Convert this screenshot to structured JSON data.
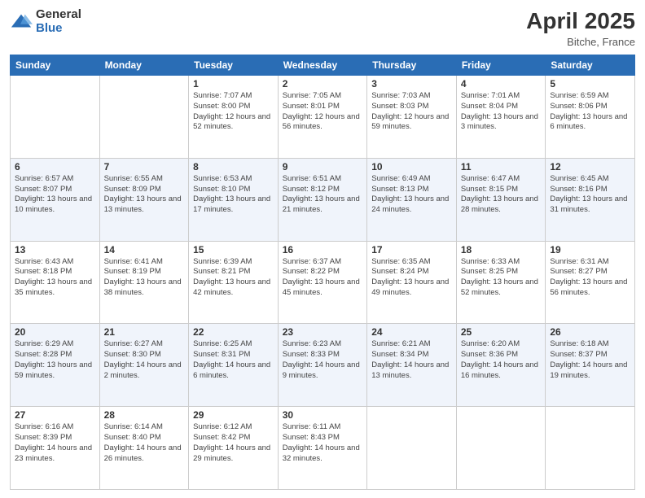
{
  "header": {
    "logo_general": "General",
    "logo_blue": "Blue",
    "title": "April 2025",
    "subtitle": "Bitche, France"
  },
  "days_of_week": [
    "Sunday",
    "Monday",
    "Tuesday",
    "Wednesday",
    "Thursday",
    "Friday",
    "Saturday"
  ],
  "weeks": [
    [
      {
        "day": "",
        "info": ""
      },
      {
        "day": "",
        "info": ""
      },
      {
        "day": "1",
        "info": "Sunrise: 7:07 AM\nSunset: 8:00 PM\nDaylight: 12 hours and 52 minutes."
      },
      {
        "day": "2",
        "info": "Sunrise: 7:05 AM\nSunset: 8:01 PM\nDaylight: 12 hours and 56 minutes."
      },
      {
        "day": "3",
        "info": "Sunrise: 7:03 AM\nSunset: 8:03 PM\nDaylight: 12 hours and 59 minutes."
      },
      {
        "day": "4",
        "info": "Sunrise: 7:01 AM\nSunset: 8:04 PM\nDaylight: 13 hours and 3 minutes."
      },
      {
        "day": "5",
        "info": "Sunrise: 6:59 AM\nSunset: 8:06 PM\nDaylight: 13 hours and 6 minutes."
      }
    ],
    [
      {
        "day": "6",
        "info": "Sunrise: 6:57 AM\nSunset: 8:07 PM\nDaylight: 13 hours and 10 minutes."
      },
      {
        "day": "7",
        "info": "Sunrise: 6:55 AM\nSunset: 8:09 PM\nDaylight: 13 hours and 13 minutes."
      },
      {
        "day": "8",
        "info": "Sunrise: 6:53 AM\nSunset: 8:10 PM\nDaylight: 13 hours and 17 minutes."
      },
      {
        "day": "9",
        "info": "Sunrise: 6:51 AM\nSunset: 8:12 PM\nDaylight: 13 hours and 21 minutes."
      },
      {
        "day": "10",
        "info": "Sunrise: 6:49 AM\nSunset: 8:13 PM\nDaylight: 13 hours and 24 minutes."
      },
      {
        "day": "11",
        "info": "Sunrise: 6:47 AM\nSunset: 8:15 PM\nDaylight: 13 hours and 28 minutes."
      },
      {
        "day": "12",
        "info": "Sunrise: 6:45 AM\nSunset: 8:16 PM\nDaylight: 13 hours and 31 minutes."
      }
    ],
    [
      {
        "day": "13",
        "info": "Sunrise: 6:43 AM\nSunset: 8:18 PM\nDaylight: 13 hours and 35 minutes."
      },
      {
        "day": "14",
        "info": "Sunrise: 6:41 AM\nSunset: 8:19 PM\nDaylight: 13 hours and 38 minutes."
      },
      {
        "day": "15",
        "info": "Sunrise: 6:39 AM\nSunset: 8:21 PM\nDaylight: 13 hours and 42 minutes."
      },
      {
        "day": "16",
        "info": "Sunrise: 6:37 AM\nSunset: 8:22 PM\nDaylight: 13 hours and 45 minutes."
      },
      {
        "day": "17",
        "info": "Sunrise: 6:35 AM\nSunset: 8:24 PM\nDaylight: 13 hours and 49 minutes."
      },
      {
        "day": "18",
        "info": "Sunrise: 6:33 AM\nSunset: 8:25 PM\nDaylight: 13 hours and 52 minutes."
      },
      {
        "day": "19",
        "info": "Sunrise: 6:31 AM\nSunset: 8:27 PM\nDaylight: 13 hours and 56 minutes."
      }
    ],
    [
      {
        "day": "20",
        "info": "Sunrise: 6:29 AM\nSunset: 8:28 PM\nDaylight: 13 hours and 59 minutes."
      },
      {
        "day": "21",
        "info": "Sunrise: 6:27 AM\nSunset: 8:30 PM\nDaylight: 14 hours and 2 minutes."
      },
      {
        "day": "22",
        "info": "Sunrise: 6:25 AM\nSunset: 8:31 PM\nDaylight: 14 hours and 6 minutes."
      },
      {
        "day": "23",
        "info": "Sunrise: 6:23 AM\nSunset: 8:33 PM\nDaylight: 14 hours and 9 minutes."
      },
      {
        "day": "24",
        "info": "Sunrise: 6:21 AM\nSunset: 8:34 PM\nDaylight: 14 hours and 13 minutes."
      },
      {
        "day": "25",
        "info": "Sunrise: 6:20 AM\nSunset: 8:36 PM\nDaylight: 14 hours and 16 minutes."
      },
      {
        "day": "26",
        "info": "Sunrise: 6:18 AM\nSunset: 8:37 PM\nDaylight: 14 hours and 19 minutes."
      }
    ],
    [
      {
        "day": "27",
        "info": "Sunrise: 6:16 AM\nSunset: 8:39 PM\nDaylight: 14 hours and 23 minutes."
      },
      {
        "day": "28",
        "info": "Sunrise: 6:14 AM\nSunset: 8:40 PM\nDaylight: 14 hours and 26 minutes."
      },
      {
        "day": "29",
        "info": "Sunrise: 6:12 AM\nSunset: 8:42 PM\nDaylight: 14 hours and 29 minutes."
      },
      {
        "day": "30",
        "info": "Sunrise: 6:11 AM\nSunset: 8:43 PM\nDaylight: 14 hours and 32 minutes."
      },
      {
        "day": "",
        "info": ""
      },
      {
        "day": "",
        "info": ""
      },
      {
        "day": "",
        "info": ""
      }
    ]
  ]
}
